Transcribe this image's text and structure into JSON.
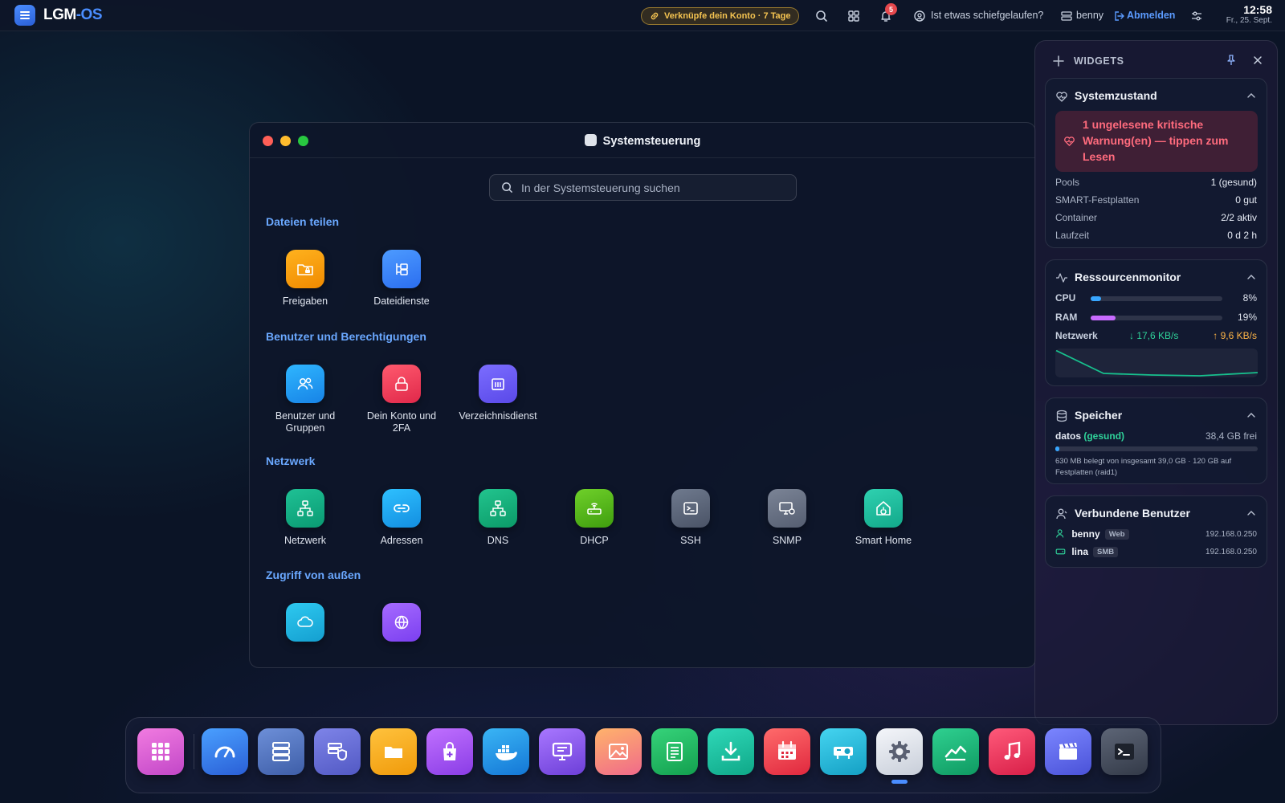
{
  "topbar": {
    "logo_main": "LGM",
    "logo_accent": "-OS",
    "promo": "Verknüpfe dein Konto · 7 Tage",
    "notification_count": "5",
    "help": "Ist etwas schiefgelaufen?",
    "user": "benny",
    "logout": "Abmelden",
    "time": "12:58",
    "date": "Fr., 25. Sept."
  },
  "window": {
    "title": "Systemsteuerung",
    "search_placeholder": "In der Systemsteuerung suchen",
    "sections": [
      {
        "title": "Dateien teilen",
        "items": [
          "Freigaben",
          "Dateidienste"
        ]
      },
      {
        "title": "Benutzer und Berechtigungen",
        "items": [
          "Benutzer und Gruppen",
          "Dein Konto und 2FA",
          "Verzeichnisdienst"
        ]
      },
      {
        "title": "Netzwerk",
        "items": [
          "Netzwerk",
          "Adressen",
          "DNS",
          "DHCP",
          "SSH",
          "SNMP",
          "Smart Home"
        ]
      },
      {
        "title": "Zugriff von außen",
        "items": [
          "",
          ""
        ]
      }
    ]
  },
  "widgets": {
    "title": "WIDGETS",
    "system": {
      "title": "Systemzustand",
      "alert": "1 ungelesene kritische Warnung(en) — tippen zum Lesen",
      "rows": [
        {
          "k": "Pools",
          "v": "1 (gesund)"
        },
        {
          "k": "SMART-Festplatten",
          "v": "0 gut"
        },
        {
          "k": "Container",
          "v": "2/2 aktiv"
        },
        {
          "k": "Laufzeit",
          "v": "0 d 2 h"
        }
      ]
    },
    "resources": {
      "title": "Ressourcenmonitor",
      "cpu_label": "CPU",
      "cpu_pct": "8%",
      "cpu_value": 0.08,
      "ram_label": "RAM",
      "ram_pct": "19%",
      "ram_value": 0.19,
      "net_label": "Netzwerk",
      "net_down": "↓ 17,6 KB/s",
      "net_up": "↑ 9,6 KB/s"
    },
    "storage": {
      "title": "Speicher",
      "pool": "datos",
      "status": "(gesund)",
      "free": "38,4 GB frei",
      "used_fraction": 0.016,
      "detail": "630 MB belegt von insgesamt 39,0 GB · 120 GB auf Festplatten (raid1)"
    },
    "users": {
      "title": "Verbundene Benutzer",
      "list": [
        {
          "name": "benny",
          "type": "Web",
          "ip": "192.168.0.250"
        },
        {
          "name": "lina",
          "type": "SMB",
          "ip": "192.168.0.250"
        }
      ]
    }
  },
  "dock": {
    "items": [
      "apps-icon",
      "dashboard-icon",
      "storage-icon",
      "security-icon",
      "files-icon",
      "store-icon",
      "docker-icon",
      "remote-desktop-icon",
      "photos-icon",
      "notes-icon",
      "download-icon",
      "calendar-icon",
      "projector-icon",
      "settings-icon",
      "monitor-icon",
      "music-icon",
      "video-icon",
      "terminal-icon"
    ]
  }
}
